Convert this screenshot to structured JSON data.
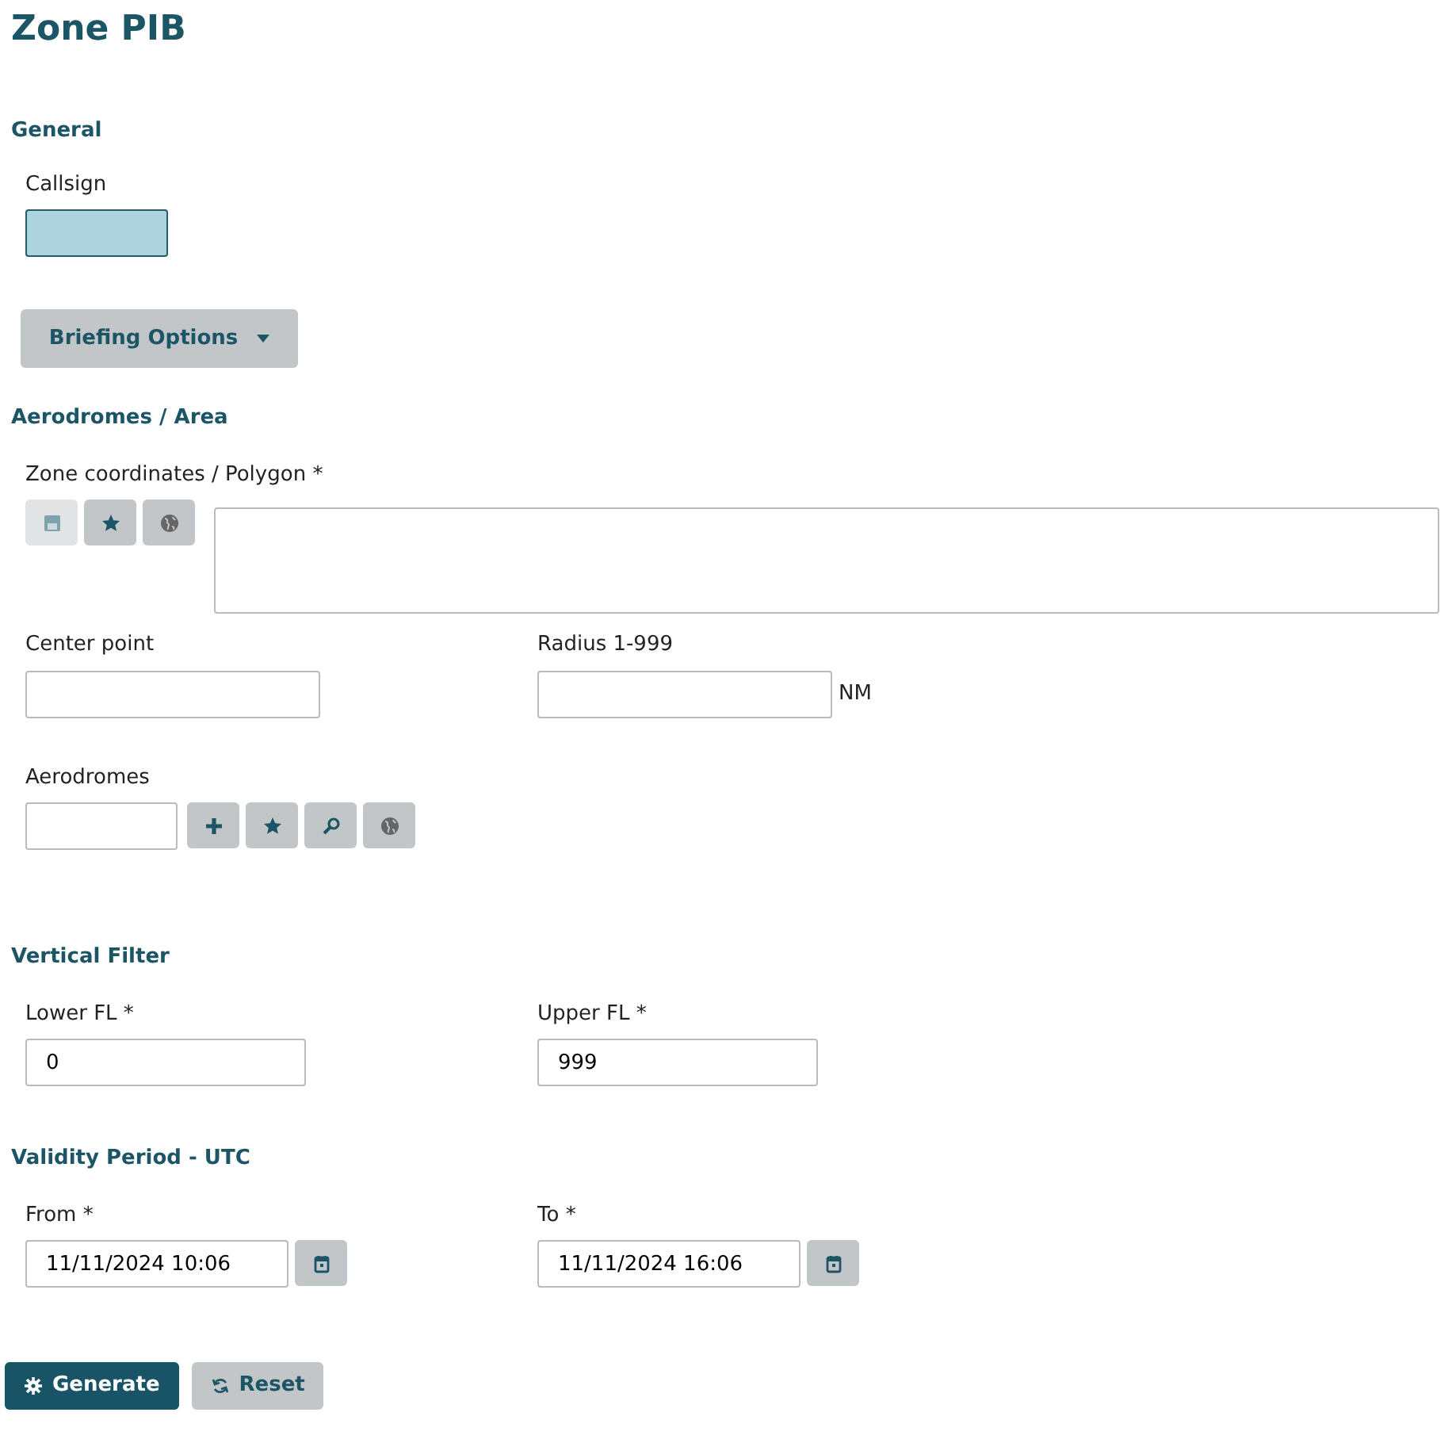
{
  "title": "Zone PIB",
  "general": {
    "heading": "General",
    "callsign": {
      "label": "Callsign"
    }
  },
  "briefing_options": {
    "label": "Briefing Options",
    "expanded": false
  },
  "area": {
    "heading": "Aerodromes / Area",
    "polygon": {
      "label": "Zone coordinates / Polygon *",
      "tools": [
        {
          "kind": "save",
          "disabled": true
        },
        {
          "kind": "star",
          "disabled": false
        },
        {
          "kind": "globe",
          "disabled": false
        }
      ]
    },
    "center": {
      "label": "Center point"
    },
    "radius": {
      "label": "Radius 1-999",
      "unit": "NM"
    },
    "aerodromes": {
      "label": "Aerodromes",
      "tools": [
        {
          "kind": "plus",
          "disabled": false
        },
        {
          "kind": "star",
          "disabled": false
        },
        {
          "kind": "search",
          "disabled": false
        },
        {
          "kind": "globe",
          "disabled": false
        }
      ]
    }
  },
  "vertical": {
    "heading": "Vertical Filter",
    "lower": {
      "label": "Lower FL *",
      "value": "0"
    },
    "upper": {
      "label": "Upper FL *",
      "value": "999"
    }
  },
  "validity": {
    "heading": "Validity Period - UTC",
    "from": {
      "label": "From *",
      "value": "11/11/2024 10:06"
    },
    "to": {
      "label": "To *",
      "value": "11/11/2024 16:06"
    }
  },
  "actions": [
    {
      "kind": "generate",
      "label": "Generate"
    },
    {
      "kind": "reset",
      "label": "Reset"
    }
  ]
}
